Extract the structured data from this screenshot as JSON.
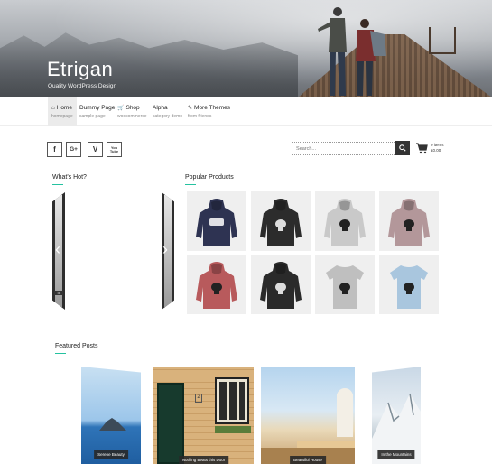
{
  "site": {
    "title": "Etrigan",
    "tagline": "Quality WordPress Design"
  },
  "nav": [
    {
      "label": "Home",
      "desc": "homepage",
      "icon": "home-icon",
      "active": true
    },
    {
      "label": "Dummy Page",
      "desc": "sample page",
      "icon": "",
      "active": false
    },
    {
      "label": "Shop",
      "desc": "woocommerce",
      "icon": "cart-icon",
      "active": false
    },
    {
      "label": "Alpha",
      "desc": "category demo",
      "icon": "",
      "active": false
    },
    {
      "label": "More Themes",
      "desc": "from friends",
      "icon": "link-icon",
      "active": false
    }
  ],
  "social": [
    "f",
    "G+",
    "V",
    "You Tube"
  ],
  "search": {
    "placeholder": "Search..."
  },
  "cart": {
    "items": "0 items",
    "total": "£0.00"
  },
  "sections": {
    "hot": "What's Hot?",
    "popular": "Popular Products",
    "featured": "Featured Posts"
  },
  "hot_caption": "Tit",
  "products": [
    {
      "color": "#2e3352",
      "kind": "hoodie",
      "print": "woo"
    },
    {
      "color": "#2c2c2c",
      "kind": "hoodie",
      "print": "ninja"
    },
    {
      "color": "#c9c9c9",
      "kind": "hoodie",
      "print": "ninja"
    },
    {
      "color": "#b3979a",
      "kind": "hoodie",
      "print": "ninja"
    },
    {
      "color": "#b85a5c",
      "kind": "hoodie",
      "print": "ninja"
    },
    {
      "color": "#2a2a2a",
      "kind": "hoodie",
      "print": "ninja"
    },
    {
      "color": "#bfbfbf",
      "kind": "tshirt",
      "print": "ninja"
    },
    {
      "color": "#a9c6de",
      "kind": "tshirt",
      "print": "ninja"
    }
  ],
  "posts": [
    {
      "caption": "Serene Beauty"
    },
    {
      "caption": "Nothing Beats this Door"
    },
    {
      "caption": "Beautiful House"
    },
    {
      "caption": "In the Mountains"
    }
  ],
  "colors": {
    "accent": "#25c2a0"
  }
}
